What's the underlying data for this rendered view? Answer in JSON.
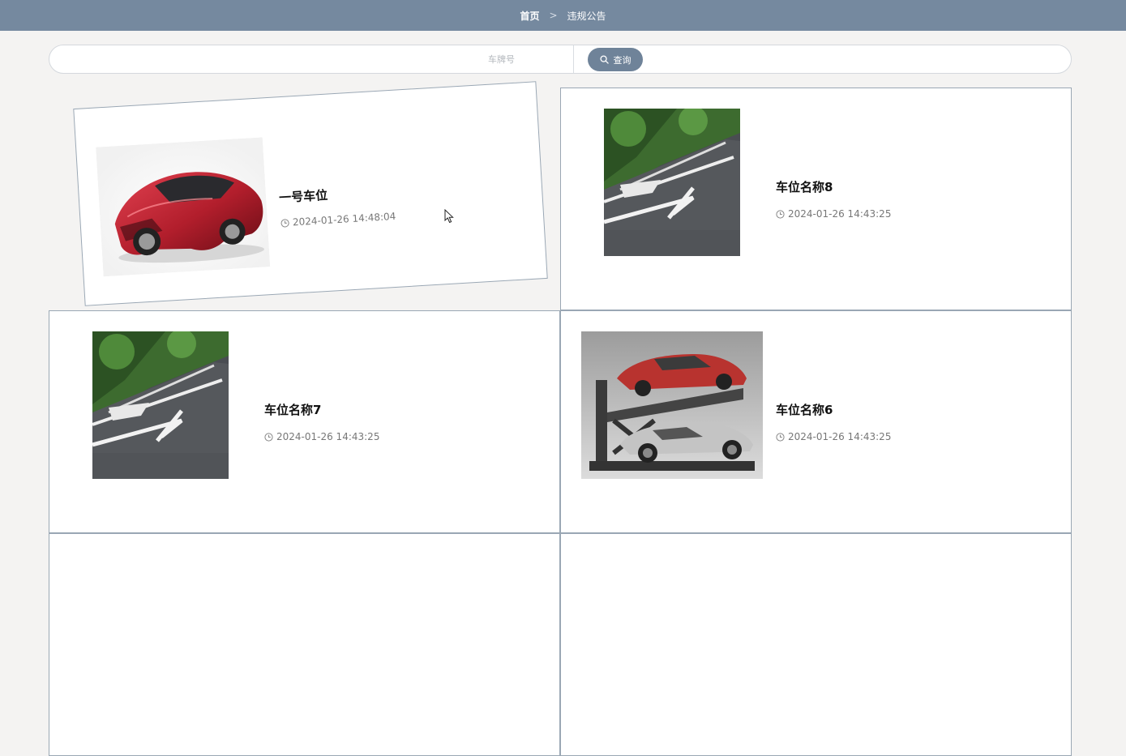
{
  "breadcrumb": {
    "home": "首页",
    "separator": ">",
    "current": "违规公告"
  },
  "search": {
    "placeholder": "车牌号",
    "button_label": "查询"
  },
  "colors": {
    "header_bg": "#75899f",
    "button_bg": "#6f8399",
    "card_border": "#9aa7b4"
  },
  "items": [
    {
      "title": "一号车位",
      "time": "2024-01-26 14:48:04",
      "image": "red-sports-car"
    },
    {
      "title": "车位名称8",
      "time": "2024-01-26 14:43:25",
      "image": "parking-space-photo"
    },
    {
      "title": "车位名称7",
      "time": "2024-01-26 14:43:25",
      "image": "parking-space-photo"
    },
    {
      "title": "车位名称6",
      "time": "2024-01-26 14:43:25",
      "image": "car-parking-lift"
    }
  ]
}
